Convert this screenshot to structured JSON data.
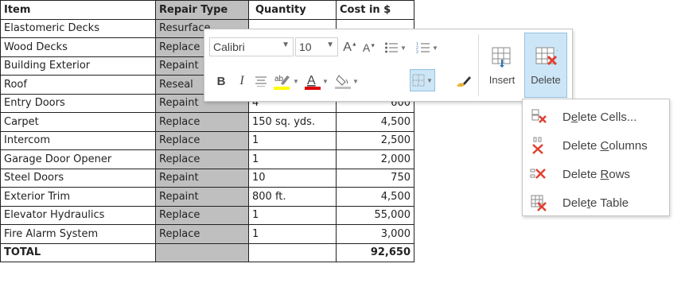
{
  "table": {
    "headers": [
      "Item",
      "Repair Type",
      "Quantity",
      "Cost in $"
    ],
    "rows": [
      [
        "Elastomeric Decks",
        "Resurface",
        "",
        ""
      ],
      [
        "Wood Decks",
        "Replace",
        "",
        ""
      ],
      [
        "Building Exterior",
        "Repaint",
        "",
        ""
      ],
      [
        "Roof",
        "Reseal",
        "",
        ""
      ],
      [
        "Entry Doors",
        "Repaint",
        "4",
        "600"
      ],
      [
        "Carpet",
        "Replace",
        "150 sq. yds.",
        "4,500"
      ],
      [
        "Intercom",
        "Replace",
        "1",
        "2,500"
      ],
      [
        "Garage Door Opener",
        "Replace",
        "1",
        "2,000"
      ],
      [
        "Steel Doors",
        "Repaint",
        "10",
        "750"
      ],
      [
        "Exterior Trim",
        "Repaint",
        "800 ft.",
        "4,500"
      ],
      [
        "Elevator Hydraulics",
        "Replace",
        "1",
        "55,000"
      ],
      [
        "Fire Alarm System",
        "Replace",
        "1",
        "3,000"
      ]
    ],
    "total": [
      "TOTAL",
      "",
      "",
      "92,650"
    ]
  },
  "toolbar": {
    "font_name": "Calibri",
    "font_size": "10",
    "bold": "B",
    "italic": "I",
    "insert_label": "Insert",
    "delete_label": "Delete",
    "highlight_color": "#ffff00",
    "font_color": "#e00000"
  },
  "delete_menu": {
    "items": [
      {
        "pre": "D",
        "accel": "e",
        "post": "lete Cells..."
      },
      {
        "pre": "Delete ",
        "accel": "C",
        "post": "olumns"
      },
      {
        "pre": "Delete ",
        "accel": "R",
        "post": "ows"
      },
      {
        "pre": "Dele",
        "accel": "t",
        "post": "e Table"
      }
    ]
  }
}
